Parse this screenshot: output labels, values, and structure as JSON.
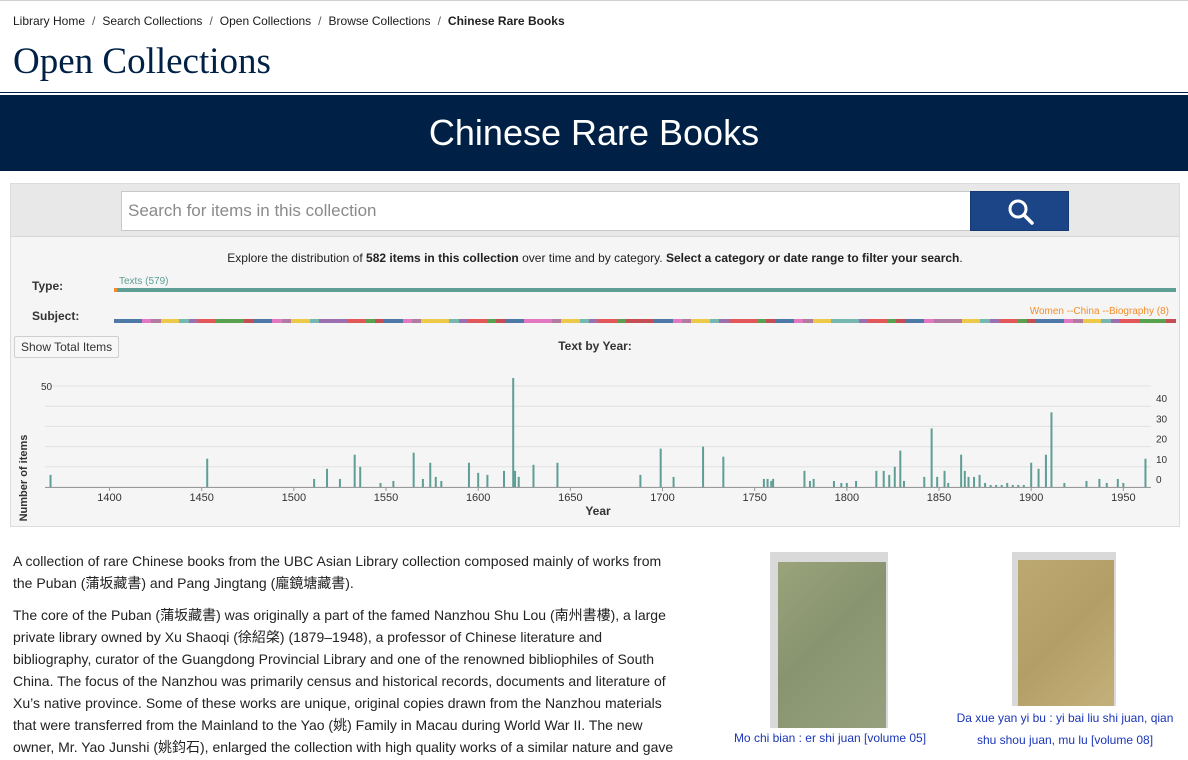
{
  "breadcrumb": {
    "items": [
      "Library Home",
      "Search Collections",
      "Open Collections",
      "Browse Collections"
    ],
    "current": "Chinese Rare Books",
    "separator": "/"
  },
  "site_title": "Open Collections",
  "banner_title": "Chinese Rare Books",
  "search": {
    "placeholder": "Search for items in this collection",
    "button_icon": "search-icon"
  },
  "explore": {
    "prefix": "Explore the distribution of",
    "count_text": "582 items in this collection",
    "middle": "over time and by category.",
    "cta": "Select a category or date range to filter your search",
    "suffix": "."
  },
  "filters": {
    "type_label": "Type:",
    "type_caption": "Texts (579)",
    "subject_label": "Subject:",
    "subject_caption": "Women --China --Biography (8)"
  },
  "show_total_label": "Show Total Items",
  "colors": {
    "brand": "#002145",
    "search_button": "#1c4587",
    "series": "#5e9e95",
    "accent": "#f28e2b",
    "link": "#1a35b8",
    "subject_palette": [
      "#4e79a7",
      "#59a14f",
      "#9c6fb0",
      "#f28e2b",
      "#edc948",
      "#e377c2",
      "#c44e52",
      "#8c564b",
      "#e15759",
      "#76b7b2",
      "#b07aa1",
      "#ff9da7"
    ]
  },
  "chart_data": {
    "type": "bar",
    "title": "Text by Year:",
    "xlabel": "Year",
    "ylabel": "Number of items",
    "xlim": [
      1365,
      1965
    ],
    "ylim": [
      0,
      53
    ],
    "x_ticks": [
      1400,
      1450,
      1500,
      1550,
      1600,
      1650,
      1700,
      1750,
      1800,
      1850,
      1900,
      1950
    ],
    "y_tick_left": [
      50
    ],
    "y_ticks_right": [
      0,
      10,
      20,
      30,
      40
    ],
    "grid": true,
    "x": [
      1368,
      1453,
      1511,
      1518,
      1525,
      1533,
      1536,
      1547,
      1554,
      1565,
      1570,
      1574,
      1577,
      1580,
      1595,
      1600,
      1605,
      1614,
      1619,
      1620,
      1622,
      1630,
      1643,
      1688,
      1699,
      1706,
      1722,
      1733,
      1755,
      1757,
      1759,
      1760,
      1777,
      1780,
      1782,
      1793,
      1797,
      1800,
      1805,
      1816,
      1820,
      1823,
      1826,
      1829,
      1831,
      1842,
      1846,
      1849,
      1853,
      1855,
      1862,
      1864,
      1866,
      1869,
      1872,
      1875,
      1878,
      1881,
      1884,
      1887,
      1890,
      1893,
      1896,
      1900,
      1904,
      1908,
      1911,
      1918,
      1930,
      1937,
      1941,
      1947,
      1950,
      1962
    ],
    "values": [
      6,
      14,
      4,
      9,
      4,
      16,
      10,
      2,
      3,
      17,
      4,
      12,
      5,
      3,
      12,
      7,
      6,
      8,
      54,
      8,
      5,
      11,
      12,
      6,
      19,
      5,
      20,
      15,
      4,
      4,
      3,
      4,
      8,
      3,
      4,
      3,
      2,
      2,
      3,
      8,
      8,
      6,
      10,
      18,
      3,
      5,
      29,
      5,
      8,
      2,
      16,
      8,
      5,
      5,
      6,
      2,
      1,
      1,
      1,
      2,
      1,
      1,
      1,
      12,
      9,
      16,
      37,
      2,
      3,
      4,
      2,
      4,
      2,
      14
    ]
  },
  "description": {
    "p1": "A collection of rare Chinese books from the UBC Asian Library collection composed mainly of works from the Puban (蒲坂藏書) and Pang Jingtang (龐鏡塘藏書).",
    "p2": "The core of the Puban (蒲坂藏書) was originally a part of the famed Nanzhou Shu Lou (南州書樓), a large private library owned by Xu Shaoqi (徐紹棨) (1879–1948), a professor of Chinese literature and bibliography, curator of the Guangdong Provincial Library and one of the renowned bibliophiles of South China. The focus of the Nanzhou was primarily census and historical records, documents and literature of Xu’s native province. Some of these works are unique, original copies drawn from the Nanzhou materials that were transferred from the Mainland to the Yao (姚) Family in Macau during World War II. The new owner, Mr. Yao Junshi (姚鈞石), enlarged the collection with high quality works of a similar nature and gave"
  },
  "featured": [
    {
      "caption": "Mo chi bian : er shi juan [volume 05]"
    },
    {
      "caption": "Da xue yan yi bu : yi bai liu shi juan, qian shu shou juan, mu lu [volume 08]"
    }
  ]
}
